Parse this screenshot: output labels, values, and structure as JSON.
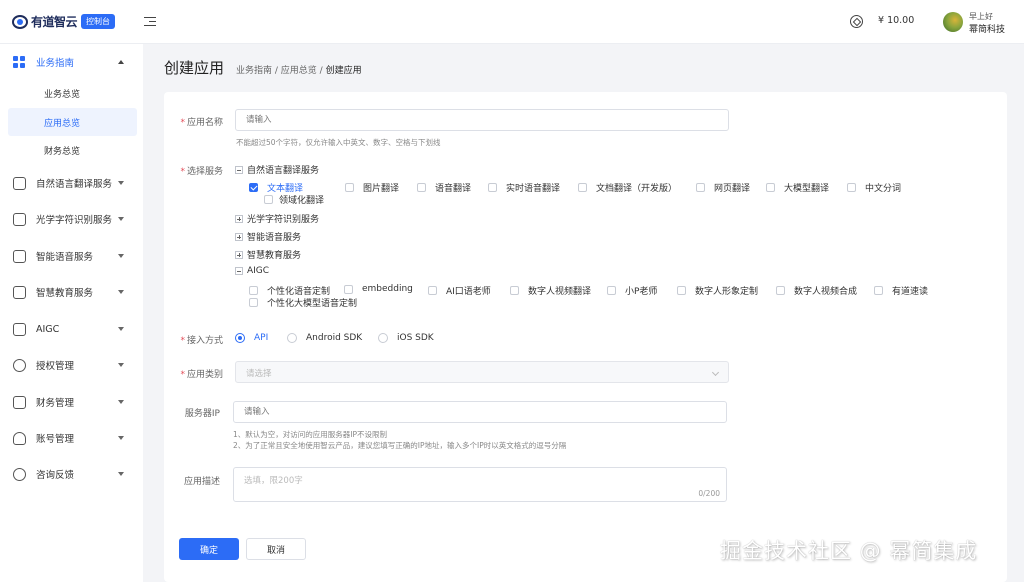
{
  "brand": {
    "name": "有道智云",
    "badge": "控制台"
  },
  "header": {
    "balance": "¥ 10.00",
    "greeting": "早上好",
    "user": "幂简科技"
  },
  "sidebar": {
    "groups": [
      {
        "label": "业务指南",
        "icon": "dashboard-icon"
      },
      {
        "label": "自然语言翻译服务",
        "icon": "translate-icon"
      },
      {
        "label": "光学字符识别服务",
        "icon": "ocr-scan-icon"
      },
      {
        "label": "智能语音服务",
        "icon": "voice-icon"
      },
      {
        "label": "智慧教育服务",
        "icon": "education-icon"
      },
      {
        "label": "AIGC",
        "icon": "aigc-icon"
      },
      {
        "label": "授权管理",
        "icon": "shield-icon"
      },
      {
        "label": "财务管理",
        "icon": "finance-icon"
      },
      {
        "label": "账号管理",
        "icon": "account-icon"
      },
      {
        "label": "咨询反馈",
        "icon": "feedback-icon"
      }
    ],
    "subitems": [
      "业务总览",
      "应用总览",
      "财务总览"
    ]
  },
  "page": {
    "title": "创建应用",
    "breadcrumb": {
      "a": "业务指南",
      "b": "应用总览",
      "c": "创建应用",
      "sep": " / "
    }
  },
  "form": {
    "app_name": {
      "label": "应用名称",
      "placeholder": "请输入",
      "hint": "不能超过50个字符，仅允许输入中英文、数字、空格与下划线"
    },
    "services": {
      "label": "选择服务",
      "nlp": "自然语言翻译服务",
      "nlp_items": [
        "文本翻译",
        "图片翻译",
        "语音翻译",
        "实时语音翻译",
        "文档翻译（开发版）",
        "网页翻译",
        "大模型翻译",
        "中文分词"
      ],
      "nlp_sub": "领域化翻译",
      "ocr": "光学字符识别服务",
      "speech": "智能语音服务",
      "edu": "智慧教育服务",
      "aigc": "AIGC",
      "aigc_items": [
        "个性化语音定制",
        "embedding",
        "AI口语老师",
        "数字人视频翻译",
        "小P老师",
        "数字人形象定制",
        "数字人视频合成",
        "有道速读"
      ],
      "aigc_sub": "个性化大模型语音定制"
    },
    "access": {
      "label": "接入方式",
      "options": [
        "API",
        "Android SDK",
        "iOS SDK"
      ]
    },
    "category": {
      "label": "应用类别",
      "placeholder": "请选择"
    },
    "server_ip": {
      "label": "服务器IP",
      "placeholder": "请输入",
      "hint1": "1、默认为空，对访问的应用服务器IP不设限制",
      "hint2": "2、为了正常且安全地使用智云产品，建议您填写正确的IP地址，输入多个IP时以英文格式的逗号分隔"
    },
    "desc": {
      "label": "应用描述",
      "placeholder": "选填，限200字",
      "counter": "0/200"
    },
    "confirm": "确定",
    "cancel": "取消"
  },
  "watermark": "掘金技术社区 @ 幂简集成"
}
